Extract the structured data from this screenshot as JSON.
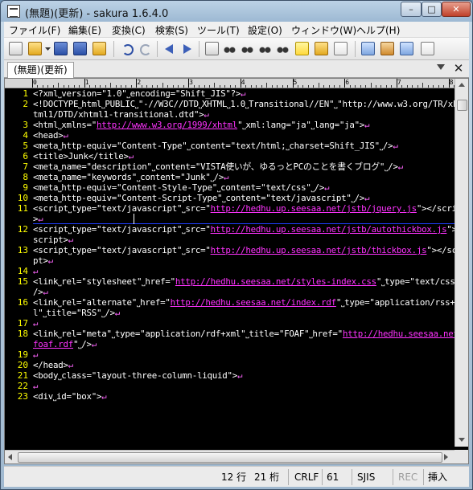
{
  "window": {
    "title": "(無題)(更新) - sakura 1.6.4.0",
    "controls": {
      "minimize": "–",
      "maximize": "□",
      "close": "✕"
    }
  },
  "menu": [
    "ファイル(F)",
    "編集(E)",
    "変換(C)",
    "検索(S)",
    "ツール(T)",
    "設定(O)",
    "ウィンドウ(W)",
    "ヘルプ(H)"
  ],
  "toolbar": {
    "icons": [
      "new-doc",
      "open-folder",
      "dropdown",
      "save",
      "save-all",
      "open-file",
      "undo",
      "redo",
      "jump-back",
      "jump-forward",
      "copy-path",
      "find",
      "find-next",
      "find-prev",
      "replace",
      "search-mark",
      "grep",
      "tag-jump",
      "outline",
      "compare",
      "external-cmd",
      "settings"
    ]
  },
  "tabs": {
    "active": "(無題)(更新)",
    "close_label": "✕"
  },
  "ruler": {
    "labels": [
      "0",
      "1",
      "2",
      "3",
      "4",
      "5",
      "6",
      "7",
      "8"
    ]
  },
  "editor": {
    "lines": [
      {
        "num": "1",
        "text": "<?xml˽version=\"1.0\"˽encoding=\"Shift_JIS\"?>",
        "cr": "↵"
      },
      {
        "num": "2",
        "text": "<!DOCTYPE˽html˽PUBLIC˽\"-//W3C//DTD˽XHTML˽1.0˽Transitional//EN\"˽\"http://www.w3.org/TR/xh",
        "cr": ""
      },
      {
        "num": "",
        "text": "tml1/DTD/xhtml1-transitional.dtd\">",
        "cr": "↵"
      },
      {
        "num": "3",
        "text": "<html˽xmlns=\"",
        "url": "http://www.w3.org/1999/xhtml",
        "after": "\"˽xml:lang=\"ja\"˽lang=\"ja\">",
        "cr": "↵"
      },
      {
        "num": "4",
        "text": "<head>",
        "cr": "↵"
      },
      {
        "num": "5",
        "text": "<meta˽http-equiv=\"Content-Type\"˽content=\"text/html;˽charset=Shift_JIS\"˽/>",
        "cr": "↵"
      },
      {
        "num": "6",
        "text": "<title>Junk</title>",
        "cr": "↵"
      },
      {
        "num": "7",
        "text": "<meta˽name=\"description\"˽content=\"VISTA使いが、ゆるっとPCのことを書くブログ\"˽/>",
        "cr": "↵"
      },
      {
        "num": "8",
        "text": "<meta˽name=\"keywords\"˽content=\"Junk\"˽/>",
        "cr": "↵"
      },
      {
        "num": "9",
        "text": "<meta˽http-equiv=\"Content-Style-Type\"˽content=\"text/css\"˽/>",
        "cr": "↵"
      },
      {
        "num": "10",
        "text": "<meta˽http-equiv=\"Content-Script-Type\"˽content=\"text/javascript\"˽/>",
        "cr": "↵"
      },
      {
        "num": "11",
        "text": "<script˽type=\"text/javascript\"˽src=\"",
        "url": "http://hedhu.up.seesaa.net/jstb/jquery.js",
        "after": "\"></script",
        "cr": ""
      },
      {
        "num": "",
        "text": ">",
        "cr": "↵"
      },
      {
        "num": "12",
        "text": "<script˽type=\"text/javascript\"˽src=\"",
        "url": "http://hedhu.up.seesaa.net/jstb/autothickbox.js",
        "after": "\"></",
        "cr": ""
      },
      {
        "num": "",
        "text": "script>",
        "cr": "↵"
      },
      {
        "num": "13",
        "text": "<script˽type=\"text/javascript\"˽src=\"",
        "url": "http://hedhu.up.seesaa.net/jstb/thickbox.js",
        "after": "\"></scri",
        "cr": ""
      },
      {
        "num": "",
        "text": "pt>",
        "cr": "↵"
      },
      {
        "num": "14",
        "text": "",
        "cr": "↵"
      },
      {
        "num": "15",
        "text": "<link˽rel=\"stylesheet\"˽href=\"",
        "url": "http://hedhu.seesaa.net/styles-index.css",
        "after": "\"˽type=\"text/css\"˽",
        "cr": ""
      },
      {
        "num": "",
        "text": "/>",
        "cr": "↵"
      },
      {
        "num": "16",
        "text": "<link˽rel=\"alternate\"˽href=\"",
        "url": "http://hedhu.seesaa.net/index.rdf",
        "after": "\"˽type=\"application/rss+xm",
        "cr": ""
      },
      {
        "num": "",
        "text": "l\"˽title=\"RSS\"˽/>",
        "cr": "↵"
      },
      {
        "num": "17",
        "text": "",
        "cr": "↵"
      },
      {
        "num": "18",
        "text": "<link˽rel=\"meta\"˽type=\"application/rdf+xml\"˽title=\"FOAF\"˽href=\"",
        "url": "http://hedhu.seesaa.net/",
        "after": "",
        "cr": ""
      },
      {
        "num": "",
        "text": "",
        "url": "foaf.rdf",
        "after": "\"˽/>",
        "cr": "↵"
      },
      {
        "num": "19",
        "text": "",
        "cr": "↵"
      },
      {
        "num": "20",
        "text": "</head>",
        "cr": "↵"
      },
      {
        "num": "21",
        "text": "<body˽class=\"layout-three-column-liquid\">",
        "cr": "↵"
      },
      {
        "num": "22",
        "text": "",
        "cr": "↵"
      },
      {
        "num": "23",
        "text": "<div˽id=\"box\">",
        "cr": "↵"
      }
    ]
  },
  "status": {
    "line": "12 行",
    "col": "21 桁",
    "eol": "CRLF",
    "code": "61",
    "encoding": "SJIS",
    "rec": "REC",
    "mode": "挿入"
  },
  "colors": {
    "editor_bg": "#000000",
    "text": "#ffffff",
    "line_numbers": "#ffff00",
    "url": "#ff33ff",
    "eol_mark": "#ff66ff",
    "cursor_line": "#1f3fff"
  }
}
